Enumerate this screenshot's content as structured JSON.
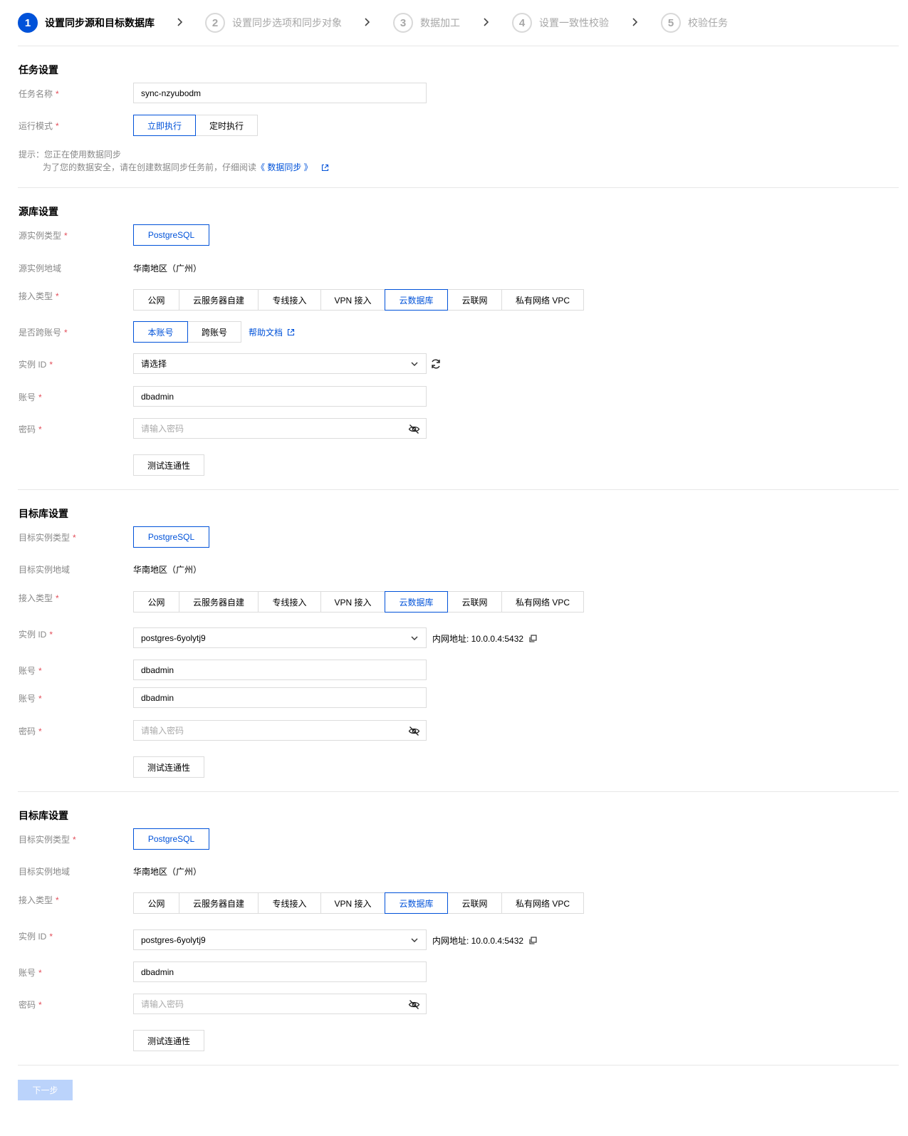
{
  "steps": [
    {
      "num": "1",
      "label": "设置同步源和目标数据库"
    },
    {
      "num": "2",
      "label": "设置同步选项和同步对象"
    },
    {
      "num": "3",
      "label": "数据加工"
    },
    {
      "num": "4",
      "label": "设置一致性校验"
    },
    {
      "num": "5",
      "label": "校验任务"
    }
  ],
  "task": {
    "title": "任务设置",
    "name_label": "任务名称",
    "name_value": "sync-nzyubodm",
    "mode_label": "运行模式",
    "modes": [
      "立即执行",
      "定时执行"
    ],
    "hint_line1": "提示：您正在使用数据同步",
    "hint_line2": "为了您的数据安全，请在创建数据同步任务前，仔细阅读",
    "hint_link": "《 数据同步 》"
  },
  "source": {
    "title": "源库设置",
    "type_label": "源实例类型",
    "type_value": "PostgreSQL",
    "region_label": "源实例地域",
    "region_value": "华南地区（广州）",
    "access_label": "接入类型",
    "access_options": [
      "公网",
      "云服务器自建",
      "专线接入",
      "VPN 接入",
      "云数据库",
      "云联网",
      "私有网络 VPC"
    ],
    "cross_label": "是否跨账号",
    "cross_options": [
      "本账号",
      "跨账号"
    ],
    "help_link": "帮助文档",
    "instance_label": "实例 ID",
    "instance_value": "请选择",
    "account_label": "账号",
    "account_value": "dbadmin",
    "password_label": "密码",
    "password_placeholder": "请输入密码",
    "test_button": "测试连通性"
  },
  "target1": {
    "title": "目标库设置",
    "type_label": "目标实例类型",
    "type_value": "PostgreSQL",
    "region_label": "目标实例地域",
    "region_value": "华南地区（广州）",
    "access_label": "接入类型",
    "access_options": [
      "公网",
      "云服务器自建",
      "专线接入",
      "VPN 接入",
      "云数据库",
      "云联网",
      "私有网络 VPC"
    ],
    "instance_label": "实例 ID",
    "instance_value": "postgres-6yolytj9",
    "address": "内网地址: 10.0.0.4:5432",
    "account_label": "账号",
    "account_value": "dbadmin",
    "account2_label": "账号",
    "account2_value": "dbadmin",
    "password_label": "密码",
    "password_placeholder": "请输入密码",
    "test_button": "测试连通性"
  },
  "target2": {
    "title": "目标库设置",
    "type_label": "目标实例类型",
    "type_value": "PostgreSQL",
    "region_label": "目标实例地域",
    "region_value": "华南地区（广州）",
    "access_label": "接入类型",
    "access_options": [
      "公网",
      "云服务器自建",
      "专线接入",
      "VPN 接入",
      "云数据库",
      "云联网",
      "私有网络 VPC"
    ],
    "instance_label": "实例 ID",
    "instance_value": "postgres-6yolytj9",
    "address": "内网地址: 10.0.0.4:5432",
    "account_label": "账号",
    "account_value": "dbadmin",
    "password_label": "密码",
    "password_placeholder": "请输入密码",
    "test_button": "测试连通性"
  },
  "next_button": "下一步",
  "colors": {
    "primary": "#0052d9",
    "required": "#e34d59",
    "disabled_btn": "#bbd3fb"
  }
}
